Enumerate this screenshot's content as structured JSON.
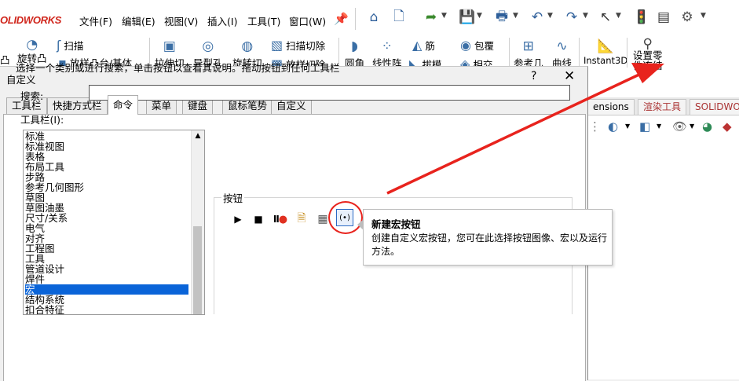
{
  "app": {
    "brand": "OLIDWORKS"
  },
  "menu": {
    "items": [
      "文件(F)",
      "编辑(E)",
      "视图(V)",
      "插入(I)",
      "工具(T)",
      "窗口(W)"
    ],
    "toolbar_icons": [
      "home-icon",
      "new-file-icon",
      "open-icon",
      "save-icon",
      "print-icon",
      "undo-icon",
      "redo-icon",
      "select-icon",
      "traffic-light-icon",
      "file-properties-icon",
      "settings-icon"
    ]
  },
  "ribbon": {
    "items": [
      "旋转凸",
      "扫描",
      "放样凸台/基体",
      "拉伸切",
      "异型孔",
      "旋转切",
      "扫描切除",
      "放样切除",
      "圆角",
      "线性阵",
      "筋",
      "拔模",
      "包覆",
      "相交",
      "参考几",
      "曲线",
      "Instant3D",
      "设置零",
      "件冻结"
    ],
    "side_label": "凸"
  },
  "bg_panel": {
    "tabs": [
      "ensions",
      "渲染工具",
      "SOLIDWOR"
    ]
  },
  "dialog": {
    "title": "自定义",
    "help": "?",
    "close": "✕",
    "tabs": [
      "工具栏",
      "快捷方式栏",
      "命令",
      "菜单",
      "键盘",
      "鼠标笔势",
      "自定义"
    ],
    "description": "选择一个类别或进行搜索，单击按钮以查看其说明。拖动按钮到任何工具栏",
    "search_label": "搜索:",
    "search_value": "",
    "toolbars_label": "工具栏(I):",
    "toolbar_list": [
      "标准",
      "标准视图",
      "表格",
      "布局工具",
      "步路",
      "参考几何图形",
      "草图",
      "草图油墨",
      "尺寸/关系",
      "电气",
      "对齐",
      "工程图",
      "工具",
      "管道设计",
      "焊件",
      "宏",
      "结构系统",
      "扣合特征"
    ],
    "selected_index": 15,
    "buttons_group_label": "按钮",
    "command_icons": [
      "run-macro-icon",
      "stop-macro-icon",
      "record-pause-macro-icon",
      "new-macro-icon",
      "edit-macro-icon",
      "new-macro-button-icon"
    ]
  },
  "tooltip": {
    "title": "新建宏按钮",
    "body": "创建自定义宏按钮，您可在此选择按钮图像、宏以及运行方法。"
  },
  "colors": {
    "accent": "#0a64d8",
    "highlight": "#e8231d",
    "brand": "#d0261c"
  }
}
